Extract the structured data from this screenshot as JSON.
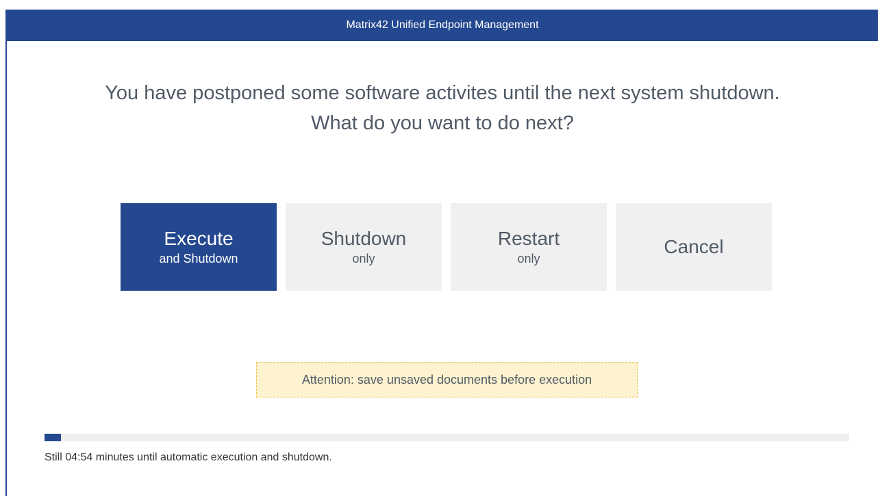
{
  "window": {
    "title": "Matrix42 Unified Endpoint Management",
    "accent_color": "#24488f"
  },
  "headline": {
    "line1": "You have postponed some software activites until the next system shutdown.",
    "line2": "What do you want to do next?"
  },
  "buttons": {
    "execute": {
      "main": "Execute",
      "sub": "and Shutdown"
    },
    "shutdown": {
      "main": "Shutdown",
      "sub": "only"
    },
    "restart": {
      "main": "Restart",
      "sub": "only"
    },
    "cancel": {
      "main": "Cancel"
    }
  },
  "attention": {
    "text": "Attention: save unsaved documents before execution"
  },
  "countdown": {
    "progress_fraction": 0.02,
    "text": "Still 04:54 minutes until automatic execution and shutdown."
  }
}
